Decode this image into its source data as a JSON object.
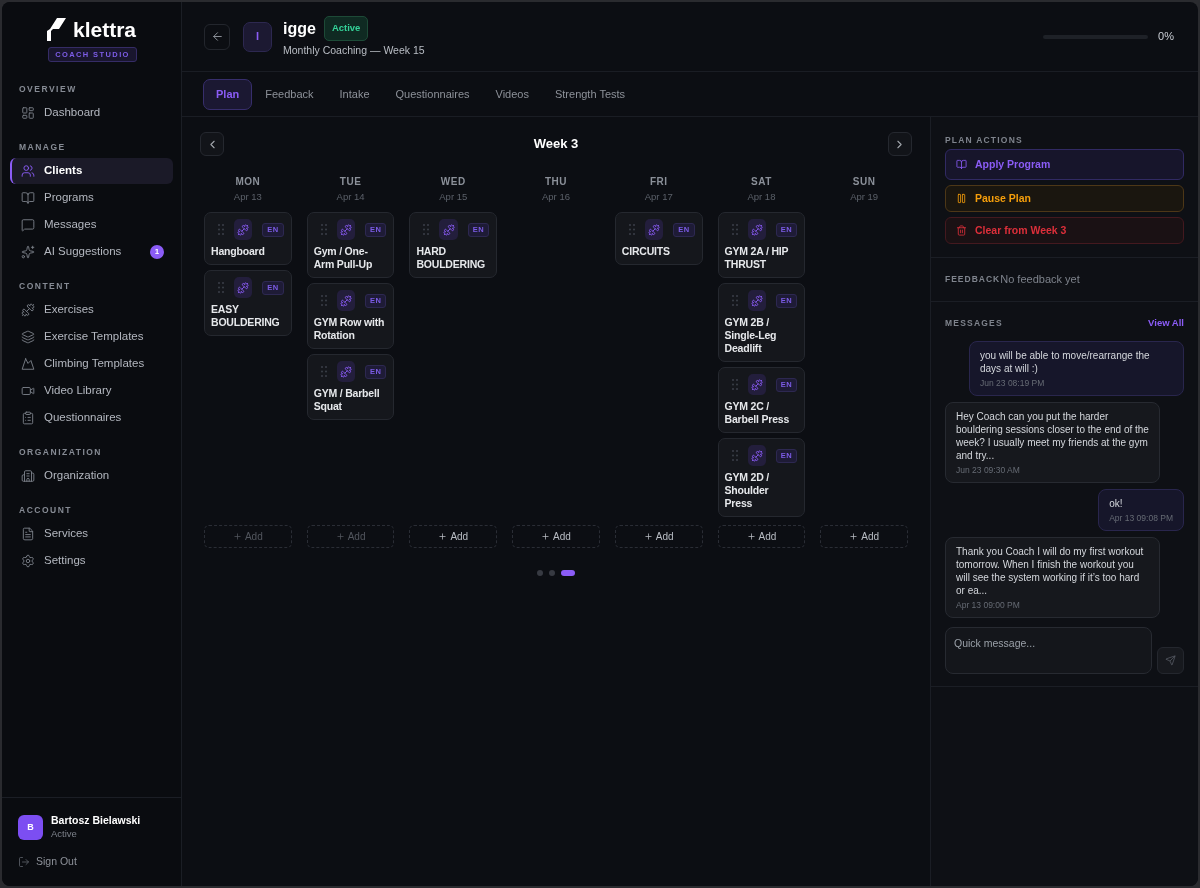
{
  "sidebar": {
    "logo": {
      "name": "klettra",
      "badge": "COACH STUDIO"
    },
    "sections": [
      {
        "title": "OVERVIEW",
        "items": [
          {
            "label": "Dashboard",
            "selected": false
          }
        ]
      },
      {
        "title": "MANAGE",
        "items": [
          {
            "label": "Clients",
            "selected": true
          },
          {
            "label": "Programs",
            "selected": false
          },
          {
            "label": "Messages",
            "selected": false
          },
          {
            "label": "AI Suggestions",
            "selected": false,
            "badge": "1"
          }
        ]
      },
      {
        "title": "CONTENT",
        "items": [
          {
            "label": "Exercises",
            "selected": false
          },
          {
            "label": "Exercise Templates",
            "selected": false
          },
          {
            "label": "Climbing Templates",
            "selected": false
          },
          {
            "label": "Video Library",
            "selected": false
          },
          {
            "label": "Questionnaires",
            "selected": false
          }
        ]
      },
      {
        "title": "ORGANIZATION",
        "items": [
          {
            "label": "Organization",
            "selected": false
          }
        ]
      },
      {
        "title": "ACCOUNT",
        "items": [
          {
            "label": "Services",
            "selected": false
          },
          {
            "label": "Settings",
            "selected": false
          }
        ]
      }
    ],
    "user": {
      "initial": "B",
      "name": "Bartosz Bielawski",
      "status": "Active"
    },
    "sign_out": "Sign Out"
  },
  "header": {
    "avatar_initial": "I",
    "client_name": "igge",
    "status": "Active",
    "subtitle": "Monthly Coaching — Week 15",
    "progress": {
      "level": 0,
      "reading": "0%"
    }
  },
  "tabs": [
    {
      "label": "Plan",
      "selected": true
    },
    {
      "label": "Feedback",
      "selected": false
    },
    {
      "label": "Intake",
      "selected": false
    },
    {
      "label": "Questionnaires",
      "selected": false
    },
    {
      "label": "Videos",
      "selected": false
    },
    {
      "label": "Strength Tests",
      "selected": false
    }
  ],
  "calendar": {
    "week_title": "Week 3",
    "days": [
      {
        "day": "MON",
        "date": "Apr 13",
        "add_label": "Add",
        "add_disabled": true,
        "workouts": [
          {
            "title": "Hangboard",
            "language": "EN"
          },
          {
            "title": "EASY BOULDERING",
            "language": "EN"
          }
        ]
      },
      {
        "day": "TUE",
        "date": "Apr 14",
        "add_label": "Add",
        "add_disabled": true,
        "workouts": [
          {
            "title": "Gym / One-Arm Pull-Up",
            "language": "EN"
          },
          {
            "title": "GYM Row with Rotation",
            "language": "EN"
          },
          {
            "title": "GYM / Barbell Squat",
            "language": "EN"
          }
        ]
      },
      {
        "day": "WED",
        "date": "Apr 15",
        "add_label": "Add",
        "add_disabled": false,
        "workouts": [
          {
            "title": "HARD BOULDERING",
            "language": "EN"
          }
        ]
      },
      {
        "day": "THU",
        "date": "Apr 16",
        "add_label": "Add",
        "add_disabled": false
      },
      {
        "day": "FRI",
        "date": "Apr 17",
        "add_label": "Add",
        "add_disabled": false,
        "workouts": [
          {
            "title": "CIRCUITS",
            "language": "EN"
          }
        ]
      },
      {
        "day": "SAT",
        "date": "Apr 18",
        "add_label": "Add",
        "add_disabled": false,
        "workouts": [
          {
            "title": "GYM 2A / HIP THRUST",
            "language": "EN"
          },
          {
            "title": "GYM 2B / Single-Leg Deadlift",
            "language": "EN"
          },
          {
            "title": "GYM 2C / Barbell Press",
            "language": "EN"
          },
          {
            "title": "GYM 2D / Shoulder Press",
            "language": "EN"
          }
        ]
      },
      {
        "day": "SUN",
        "date": "Apr 19",
        "add_label": "Add",
        "add_disabled": false
      }
    ],
    "pages": [
      {
        "selected": false
      },
      {
        "selected": false
      },
      {
        "selected": true
      }
    ]
  },
  "plan_actions": {
    "title": "PLAN ACTIONS",
    "buttons": [
      {
        "kind": "apply",
        "label": "Apply Program"
      },
      {
        "kind": "pause",
        "label": "Pause Plan"
      },
      {
        "kind": "clear",
        "label": "Clear from Week 3"
      }
    ]
  },
  "feedback": {
    "title": "FEEDBACK",
    "text": "No feedback yet"
  },
  "messages": {
    "title": "MESSAGES",
    "view_all": "View All",
    "items": [
      {
        "kind": "sent",
        "text": "you will be able to move/rearrange the days at will :)",
        "time": "Jun 23 08:19 PM"
      },
      {
        "kind": "received",
        "text": "Hey Coach can you put the harder bouldering sessions closer to the end of the week? I usually meet my friends at the gym and try...",
        "time": "Jun 23 09:30 AM"
      },
      {
        "kind": "sent",
        "text": "ok!",
        "time": "Apr 13 09:08 PM"
      },
      {
        "kind": "received",
        "text": "Thank you Coach I will do my first workout tomorrow. When I finish the workout you will see the system working if it’s too hard or ea...",
        "time": "Apr 13 09:00 PM"
      }
    ],
    "input": {
      "placeholder": "Quick message..."
    }
  }
}
